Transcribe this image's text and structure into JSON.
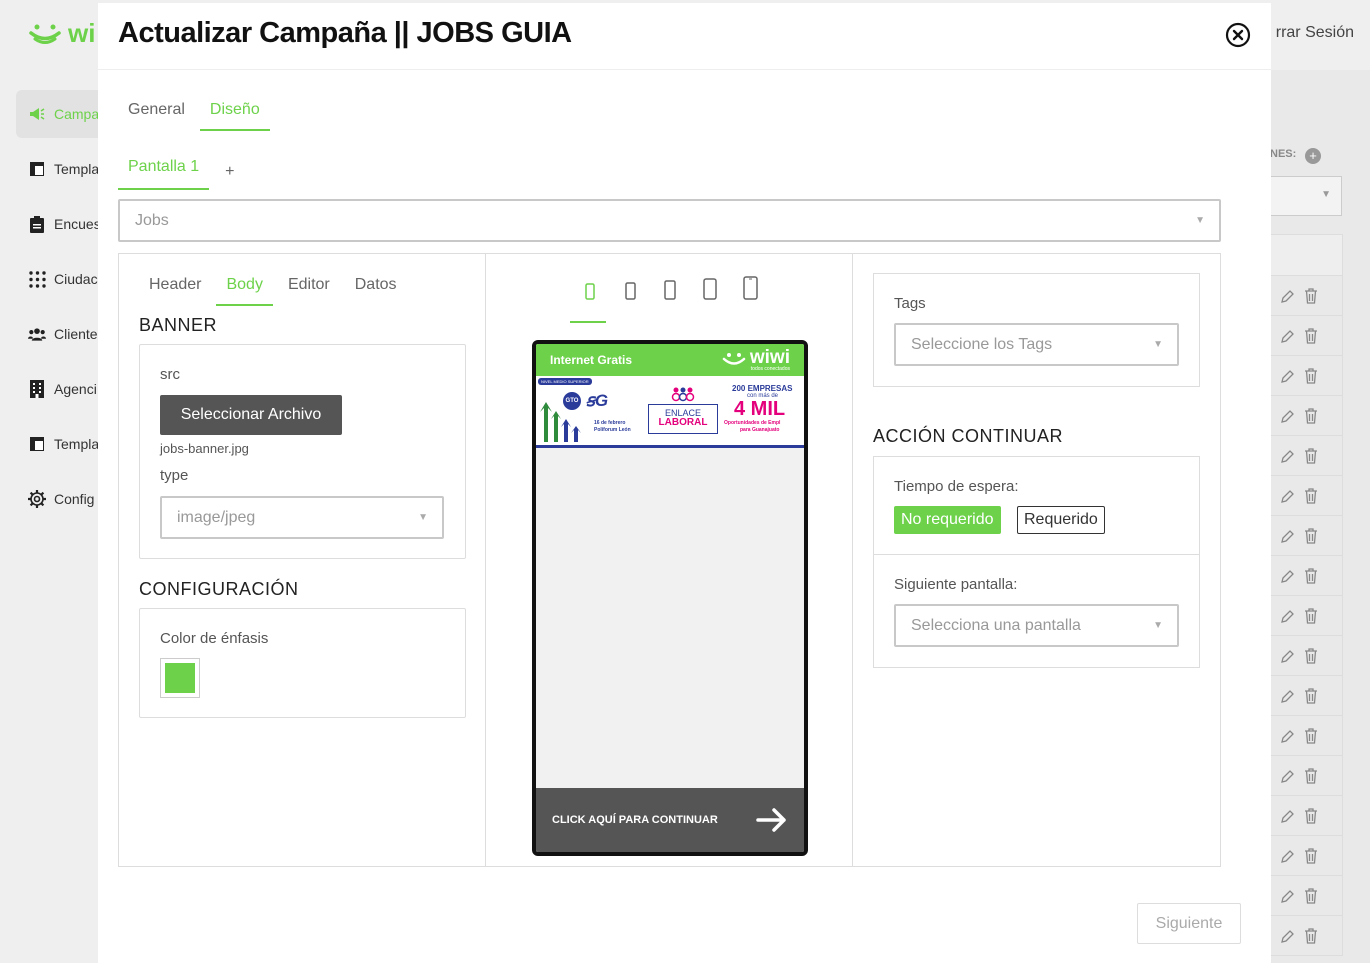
{
  "app": {
    "logo_text": "wi",
    "logout_label": "rrar Sesión"
  },
  "sidebar": {
    "items": [
      {
        "label": "Campa",
        "icon": "megaphone-icon",
        "active": true
      },
      {
        "label": "Templa",
        "icon": "layout-icon"
      },
      {
        "label": "Encues",
        "icon": "clipboard-icon"
      },
      {
        "label": "Ciudac",
        "icon": "dots-grid-icon"
      },
      {
        "label": "Cliente",
        "icon": "users-icon"
      },
      {
        "label": "Agenci",
        "icon": "building-icon"
      },
      {
        "label": "Templa",
        "icon": "layout-icon"
      },
      {
        "label": "Config",
        "icon": "gear-icon"
      }
    ]
  },
  "background_right": {
    "label": "NES:"
  },
  "modal": {
    "title": "Actualizar Campaña || JOBS GUIA",
    "tabs": [
      "General",
      "Diseño"
    ],
    "active_tab": "Diseño",
    "screen_tab": "Pantalla 1",
    "screen_add": "+",
    "template_select": "Jobs",
    "sub_tabs": [
      "Header",
      "Body",
      "Editor",
      "Datos"
    ],
    "active_sub_tab": "Body",
    "banner": {
      "title": "BANNER",
      "src_label": "src",
      "file_button": "Seleccionar Archivo",
      "file_name": "jobs-banner.jpg",
      "type_label": "type",
      "type_value": "image/jpeg"
    },
    "config": {
      "title": "CONFIGURACIÓN",
      "color_label": "Color de énfasis",
      "accent_color": "#6dd24a"
    },
    "preview": {
      "header_text": "Internet Gratis",
      "brand": "wiwi",
      "brand_tagline": "todos conectados",
      "banner_texts": {
        "badge": "NIVEL MEDIO SUPERIOR",
        "companies": "200 EMPRESAS",
        "con_mas": "con más de",
        "four_mil": "4 MIL",
        "oportunidades": "Oportunidades de Empl",
        "guanajuato": "para Guanajuato",
        "enlace": "ENLACE",
        "laboral": "LABORAL",
        "fecha": "16 de febrero",
        "lugar": "Poliforum León"
      },
      "cta": "CLICK AQUÍ PARA CONTINUAR"
    },
    "tags": {
      "label": "Tags",
      "placeholder": "Seleccione los Tags"
    },
    "action": {
      "title": "ACCIÓN CONTINUAR",
      "wait_label": "Tiempo de espera:",
      "btn_not_required": "No requerido",
      "btn_required": "Requerido",
      "next_screen_label": "Siguiente pantalla:",
      "next_screen_placeholder": "Selecciona una pantalla"
    },
    "next_button": "Siguiente"
  }
}
